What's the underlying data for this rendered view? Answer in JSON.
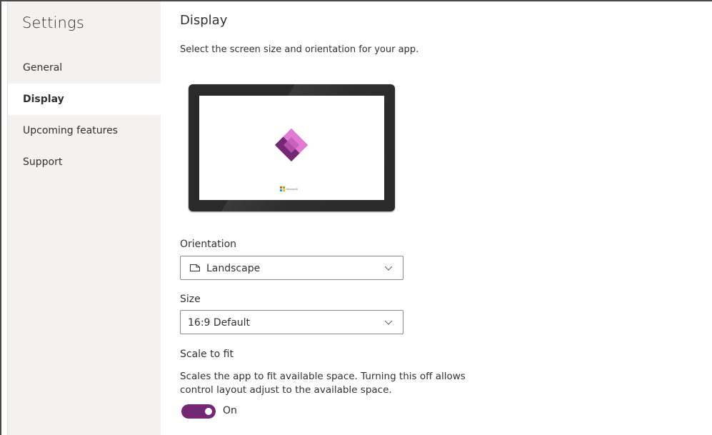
{
  "sidebar": {
    "title": "Settings",
    "items": [
      {
        "label": "General",
        "active": false
      },
      {
        "label": "Display",
        "active": true
      },
      {
        "label": "Upcoming features",
        "active": false
      },
      {
        "label": "Support",
        "active": false
      }
    ]
  },
  "main": {
    "title": "Display",
    "subtitle": "Select the screen size and orientation for your app.",
    "preview": {
      "logo_text": "Microsoft",
      "app_icon": "power-apps-icon"
    },
    "orientation": {
      "label": "Orientation",
      "value": "Landscape",
      "icon": "landscape-icon"
    },
    "size": {
      "label": "Size",
      "value": "16:9 Default"
    },
    "scale_to_fit": {
      "label": "Scale to fit",
      "description": "Scales the app to fit available space. Turning this off allows control layout adjust to the available space.",
      "toggle_state": "On",
      "enabled": true
    }
  },
  "colors": {
    "accent": "#742774",
    "sidebar_bg": "#f3f2f1",
    "text": "#323130"
  }
}
